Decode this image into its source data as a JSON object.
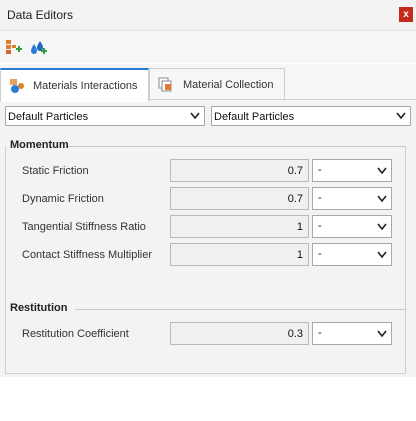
{
  "window": {
    "title": "Data Editors",
    "close_glyph": "x"
  },
  "toolbar": {
    "add_item_icon": "add-element-icon",
    "add_material_icon": "add-material-icon"
  },
  "tabs": [
    {
      "label": "Materials Interactions",
      "active": true,
      "icon": "materials-interactions-icon"
    },
    {
      "label": "Material Collection",
      "active": false,
      "icon": "material-collection-icon"
    }
  ],
  "selectors": {
    "left": "Default Particles",
    "right": "Default Particles"
  },
  "momentum": {
    "title": "Momentum",
    "rows": [
      {
        "label": "Static Friction",
        "value": "0.7",
        "unit": "-"
      },
      {
        "label": "Dynamic Friction",
        "value": "0.7",
        "unit": "-"
      },
      {
        "label": "Tangential Stiffness Ratio",
        "value": "1",
        "unit": "-"
      },
      {
        "label": "Contact Stiffness Multiplier",
        "value": "1",
        "unit": "-"
      }
    ]
  },
  "restitution": {
    "title": "Restitution",
    "rows": [
      {
        "label": "Restitution Coefficient",
        "value": "0.3",
        "unit": "-"
      }
    ]
  },
  "colors": {
    "accent": "#2a7bd6",
    "close": "#c42b1c",
    "panel": "#f3f3f3"
  }
}
